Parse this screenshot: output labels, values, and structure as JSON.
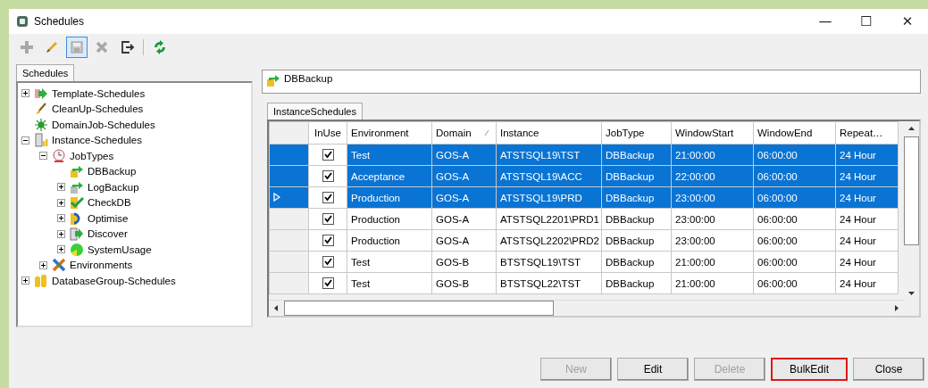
{
  "window": {
    "title": "Schedules",
    "controls": [
      "—",
      "☐",
      "✕"
    ]
  },
  "toolbar": [
    {
      "kind": "add",
      "disabled": true,
      "highlighted": false
    },
    {
      "kind": "edit",
      "disabled": false,
      "highlighted": false
    },
    {
      "kind": "save",
      "disabled": true,
      "highlighted": true
    },
    {
      "kind": "delete",
      "disabled": true,
      "highlighted": false
    },
    {
      "kind": "exit",
      "disabled": false,
      "highlighted": false
    },
    {
      "kind": "refresh",
      "disabled": false,
      "highlighted": false
    }
  ],
  "left_tabs": [
    {
      "label": "Schedules",
      "selected": true
    }
  ],
  "tree": [
    {
      "label": "Template-Schedules",
      "kind": "arrow",
      "expanded": false
    },
    {
      "label": "CleanUp-Schedules",
      "kind": "broom"
    },
    {
      "label": "DomainJob-Schedules",
      "kind": "star"
    },
    {
      "label": "Instance-Schedules",
      "kind": "server",
      "expanded": true,
      "children": [
        {
          "label": "JobTypes",
          "kind": "jobs",
          "expanded": true,
          "children": [
            {
              "label": "DBBackup",
              "kind": "backup"
            },
            {
              "label": "LogBackup",
              "kind": "logbackup",
              "expanded": false
            },
            {
              "label": "CheckDB",
              "kind": "check",
              "expanded": false
            },
            {
              "label": "Optimise",
              "kind": "optimise",
              "expanded": false
            },
            {
              "label": "Discover",
              "kind": "discover",
              "expanded": false
            },
            {
              "label": "SystemUsage",
              "kind": "pie",
              "expanded": false
            }
          ]
        },
        {
          "label": "Environments",
          "kind": "environments",
          "expanded": false
        }
      ]
    },
    {
      "label": "DatabaseGroup-Schedules",
      "kind": "group",
      "expanded": false
    }
  ],
  "header_field": {
    "value": "DBBackup"
  },
  "right_tabs": [
    {
      "label": "InstanceSchedules",
      "selected": true
    }
  ],
  "table": {
    "in_use_column": {
      "label": "InUse"
    },
    "columns": [
      {
        "label": "Environment",
        "sorted": false
      },
      {
        "label": "Domain",
        "sorted": true
      },
      {
        "label": "Instance",
        "sorted": false
      },
      {
        "label": "JobType",
        "sorted": false
      },
      {
        "label": "WindowStart",
        "sorted": false
      },
      {
        "label": "WindowEnd",
        "sorted": false
      },
      {
        "label": "Repeat…",
        "sorted": false
      }
    ],
    "rows": [
      {
        "selected": true,
        "current": false,
        "in_use": true,
        "cells": [
          "Test",
          "GOS-A",
          "ATSTSQL19\\TST",
          "DBBackup",
          "21:00:00",
          "06:00:00",
          "24 Hour"
        ]
      },
      {
        "selected": true,
        "current": false,
        "in_use": true,
        "cells": [
          "Acceptance",
          "GOS-A",
          "ATSTSQL19\\ACC",
          "DBBackup",
          "22:00:00",
          "06:00:00",
          "24 Hour"
        ]
      },
      {
        "selected": true,
        "current": true,
        "in_use": true,
        "cells": [
          "Production",
          "GOS-A",
          "ATSTSQL19\\PRD",
          "DBBackup",
          "23:00:00",
          "06:00:00",
          "24 Hour"
        ]
      },
      {
        "selected": false,
        "current": false,
        "in_use": true,
        "cells": [
          "Production",
          "GOS-A",
          "ATSTSQL2201\\PRD1",
          "DBBackup",
          "23:00:00",
          "06:00:00",
          "24 Hour"
        ]
      },
      {
        "selected": false,
        "current": false,
        "in_use": true,
        "cells": [
          "Production",
          "GOS-A",
          "ATSTSQL2202\\PRD2",
          "DBBackup",
          "23:00:00",
          "06:00:00",
          "24 Hour"
        ]
      },
      {
        "selected": false,
        "current": false,
        "in_use": true,
        "cells": [
          "Test",
          "GOS-B",
          "BTSTSQL19\\TST",
          "DBBackup",
          "21:00:00",
          "06:00:00",
          "24 Hour"
        ]
      },
      {
        "selected": false,
        "current": false,
        "in_use": true,
        "cells": [
          "Test",
          "GOS-B",
          "BTSTSQL22\\TST",
          "DBBackup",
          "21:00:00",
          "06:00:00",
          "24 Hour"
        ]
      }
    ]
  },
  "buttons": [
    {
      "label": "New",
      "disabled": true,
      "highlighted": false
    },
    {
      "label": "Edit",
      "disabled": false,
      "highlighted": false
    },
    {
      "label": "Delete",
      "disabled": true,
      "highlighted": false
    },
    {
      "label": "BulkEdit",
      "disabled": false,
      "highlighted": true
    },
    {
      "label": "Close",
      "disabled": false,
      "highlighted": false
    }
  ]
}
